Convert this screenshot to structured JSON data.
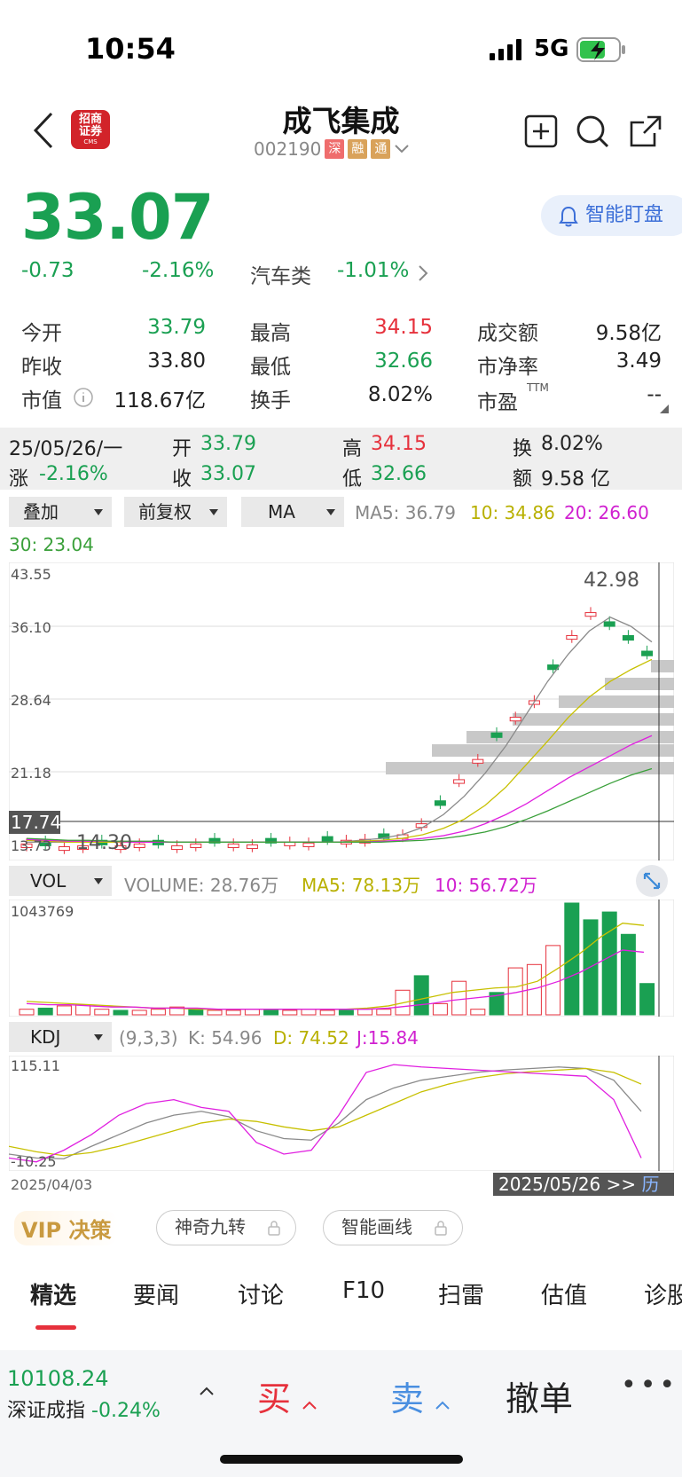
{
  "status": {
    "time": "10:54",
    "network": "5G"
  },
  "header": {
    "broker_logo_line1": "招商",
    "broker_logo_line2": "证券",
    "broker_logo_sub": "CMS",
    "stock_name": "成飞集成",
    "stock_code": "002190",
    "tags": [
      "深",
      "融",
      "通"
    ]
  },
  "quote": {
    "price": "33.07",
    "change": "-0.73",
    "change_pct": "-2.16%",
    "sector_name": "汽车类",
    "sector_pct": "-1.01%",
    "watch_label": "智能盯盘"
  },
  "stats": {
    "open_label": "今开",
    "open": "33.79",
    "high_label": "最高",
    "high": "34.15",
    "amount_label": "成交额",
    "amount": "9.58亿",
    "prev_close_label": "昨收",
    "prev_close": "33.80",
    "low_label": "最低",
    "low": "32.66",
    "pb_label": "市净率",
    "pb": "3.49",
    "mcap_label": "市值",
    "mcap": "118.67亿",
    "turnover_label": "换手",
    "turnover": "8.02%",
    "pe_label": "市盈",
    "pe_sup": "TTM",
    "pe": "--"
  },
  "day_bar": {
    "date": "25/05/26/一",
    "open_label": "开",
    "open": "33.79",
    "high_label": "高",
    "high": "34.15",
    "turn_label": "换",
    "turn": "8.02%",
    "chg_label": "涨",
    "chg": "-2.16%",
    "close_label": "收",
    "close": "33.07",
    "low_label": "低",
    "low": "32.66",
    "amt_label": "额",
    "amt": "9.58 亿"
  },
  "controls": {
    "overlay": "叠加",
    "adjust": "前复权",
    "indicator": "MA",
    "ma5": "MA5: 36.79",
    "ma10": "10: 34.86",
    "ma20": "20: 26.60",
    "ma30": "30: 23.04",
    "vol_sel": "VOL",
    "volume": "VOLUME: 28.76万",
    "vol_ma5": "MA5: 78.13万",
    "vol_ma10": "10: 56.72万",
    "kdj_sel": "KDJ",
    "kdj_params": "(9,3,3)",
    "k": "K: 54.96",
    "d": "D: 74.52",
    "j": "J:15.84"
  },
  "chart_data": {
    "type": "candlestick",
    "y_ticks": [
      "43.55",
      "36.10",
      "28.64",
      "21.18",
      "13.73"
    ],
    "current_label": "17.74",
    "high_marker": "42.98",
    "low_marker": "14.30",
    "vol_max": "1043769",
    "kdj_max": "115.11",
    "kdj_min": "-10.25",
    "start_date": "2025/04/03",
    "end_date": "2025/05/26 >>",
    "end_suffix": "历",
    "colors": {
      "up": "#e6313c",
      "down": "#1aa052",
      "ma5": "#8a8a8a",
      "ma10": "#c7c000",
      "ma20": "#e020e0",
      "ma30": "#3aa03a"
    }
  },
  "features": {
    "vip": "VIP 决策",
    "nine": "神奇九转",
    "draw": "智能画线"
  },
  "tabs": [
    "精选",
    "要闻",
    "讨论",
    "F10",
    "扫雷",
    "估值",
    "诊股"
  ],
  "bottom": {
    "index_value": "10108.24",
    "index_name": "深证成指",
    "index_pct": "-0.24%",
    "buy": "买",
    "sell": "卖",
    "cancel": "撤单",
    "more": "•••"
  }
}
